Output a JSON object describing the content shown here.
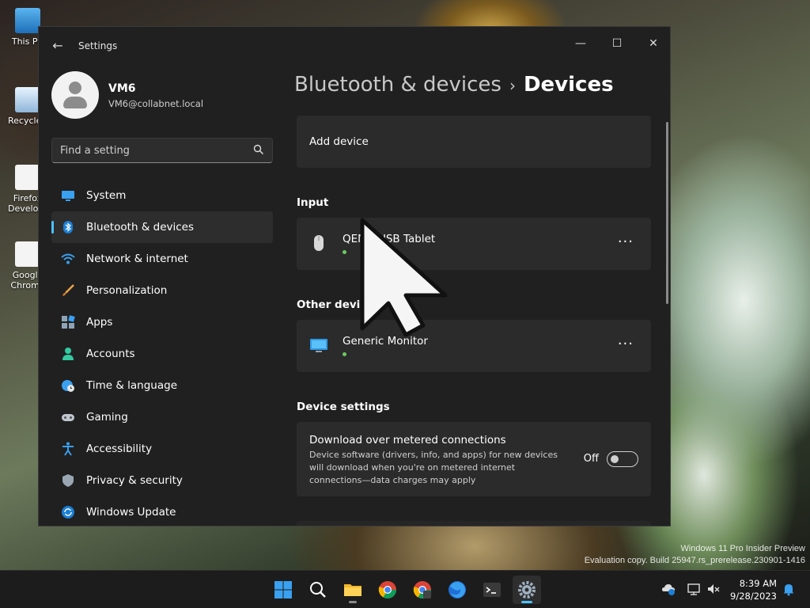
{
  "desktop": {
    "icons": [
      {
        "label": "This PC",
        "name": "desktop-icon-this-pc"
      },
      {
        "label": "Recycle Bin",
        "name": "desktop-icon-recycle-bin"
      },
      {
        "label": "Firefox Developer",
        "name": "desktop-icon-firefox-dev"
      },
      {
        "label": "Google Chrome",
        "name": "desktop-icon-chrome"
      }
    ],
    "watermark": {
      "line1": "Windows 11 Pro Insider Preview",
      "line2": "Evaluation copy. Build 25947.rs_prerelease.230901-1416"
    }
  },
  "window": {
    "title": "Settings",
    "back_glyph": "←",
    "minimize_glyph": "—",
    "maximize_glyph": "☐",
    "close_glyph": "✕"
  },
  "profile": {
    "name": "VM6",
    "email": "VM6@collabnet.local"
  },
  "search": {
    "placeholder": "Find a setting"
  },
  "nav": {
    "items": [
      {
        "label": "System",
        "icon": "system-icon"
      },
      {
        "label": "Bluetooth & devices",
        "icon": "bluetooth-icon",
        "active": true
      },
      {
        "label": "Network & internet",
        "icon": "wifi-icon"
      },
      {
        "label": "Personalization",
        "icon": "brush-icon"
      },
      {
        "label": "Apps",
        "icon": "apps-icon"
      },
      {
        "label": "Accounts",
        "icon": "accounts-icon"
      },
      {
        "label": "Time & language",
        "icon": "globe-clock-icon"
      },
      {
        "label": "Gaming",
        "icon": "gamepad-icon"
      },
      {
        "label": "Accessibility",
        "icon": "accessibility-icon"
      },
      {
        "label": "Privacy & security",
        "icon": "shield-icon"
      },
      {
        "label": "Windows Update",
        "icon": "update-icon"
      }
    ]
  },
  "main": {
    "breadcrumb": {
      "parent": "Bluetooth & devices",
      "separator": "›",
      "current": "Devices"
    },
    "add_device_label": "Add device",
    "sections": {
      "input": "Input",
      "other_devices": "Other devices",
      "device_settings": "Device settings"
    },
    "input_devices": [
      {
        "name": "QEMU USB Tablet",
        "icon": "mouse-icon",
        "status_color": "#6ccb5f"
      }
    ],
    "other_devices": [
      {
        "name": "Generic Monitor",
        "icon": "monitor-icon",
        "status_color": "#6ccb5f"
      }
    ],
    "more_glyph": "···",
    "metered": {
      "title": "Download over metered connections",
      "description": "Device software (drivers, info, and apps) for new devices will download when you're on metered internet connections—data charges may apply",
      "toggle_state": "Off"
    }
  },
  "taskbar": {
    "apps": [
      {
        "name": "start",
        "icon": "windows-start-icon"
      },
      {
        "name": "search",
        "icon": "search-icon"
      },
      {
        "name": "file-explorer",
        "icon": "folder-icon"
      },
      {
        "name": "chrome",
        "icon": "chrome-icon"
      },
      {
        "name": "chrome-dev",
        "icon": "chrome-dev-icon"
      },
      {
        "name": "firefox",
        "icon": "firefox-icon"
      },
      {
        "name": "terminal",
        "icon": "terminal-icon"
      },
      {
        "name": "settings",
        "icon": "gear-icon",
        "active": true
      }
    ],
    "clock": {
      "time": "8:39 AM",
      "date": "9/28/2023"
    }
  },
  "colors": {
    "accent": "#4cc2ff",
    "window_bg": "#202020",
    "card_bg": "#2b2b2b",
    "status_green": "#6ccb5f"
  }
}
